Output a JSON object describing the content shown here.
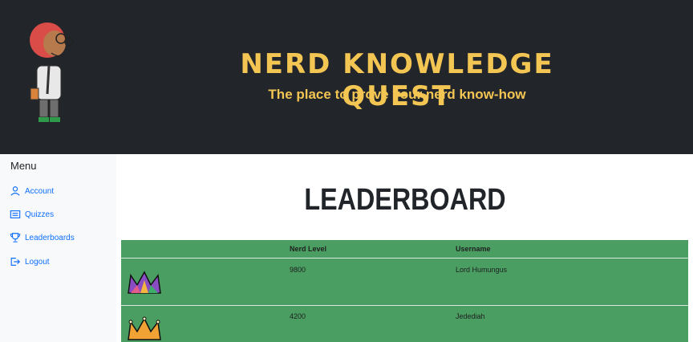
{
  "header": {
    "title": "NERD KNOWLEDGE QUEST",
    "subtitle": "The place to prove your nerd know-how"
  },
  "sidebar": {
    "title": "Menu",
    "items": [
      {
        "label": "Account",
        "icon": "user-icon"
      },
      {
        "label": "Quizzes",
        "icon": "list-icon"
      },
      {
        "label": "Leaderboards",
        "icon": "trophy-icon"
      },
      {
        "label": "Logout",
        "icon": "logout-icon"
      }
    ]
  },
  "main": {
    "title": "LEADERBOARD",
    "table": {
      "columns": [
        "",
        "Nerd Level",
        "Username"
      ],
      "rows": [
        {
          "badge": "multicolor-crown-icon",
          "level": "9800",
          "username": "Lord Humungus"
        },
        {
          "badge": "orange-crown-icon",
          "level": "4200",
          "username": "Jedediah"
        }
      ]
    }
  },
  "colors": {
    "header_bg": "#22252a",
    "title_gold": "#f3c553",
    "sidebar_bg": "#f8f9fa",
    "link_blue": "#0d6efd",
    "table_green": "#4a9e62"
  }
}
